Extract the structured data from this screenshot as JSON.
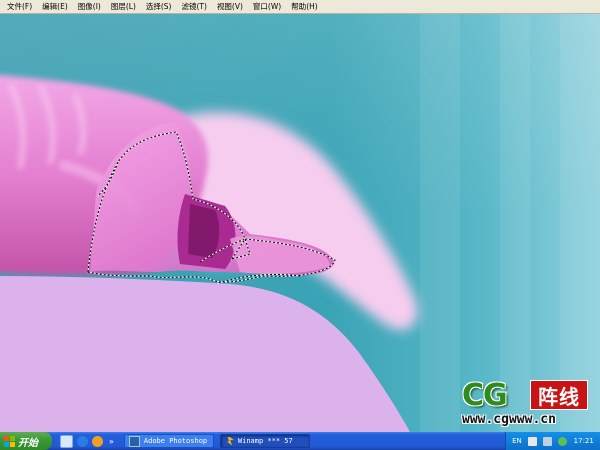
{
  "menubar": {
    "items": [
      "文件(F)",
      "编辑(E)",
      "图像(I)",
      "图层(L)",
      "选择(S)",
      "滤镜(T)",
      "视图(V)",
      "窗口(W)",
      "帮助(H)"
    ]
  },
  "watermark": {
    "letters": "CG",
    "cn": "阵线",
    "url": "www.cgwww.cn"
  },
  "taskbar": {
    "start_label": "开始",
    "quicklaunch_more": "»",
    "tasks": [
      {
        "label": "Adobe Photoshop",
        "icon": "photoshop-icon",
        "active": false
      },
      {
        "label": "Winamp *** 57",
        "icon": "winamp-icon",
        "active": true
      }
    ],
    "tray": {
      "lang": "EN",
      "clock": "17:21"
    }
  },
  "colors": {
    "sky": "#3fa6b8",
    "foreground": "#ddb2ec",
    "hand_light": "#f8c9ef",
    "hand_mid": "#e77fd6",
    "hand_dark": "#b32f99",
    "taskbar_blue": "#245edb",
    "start_green": "#3c9a35"
  }
}
